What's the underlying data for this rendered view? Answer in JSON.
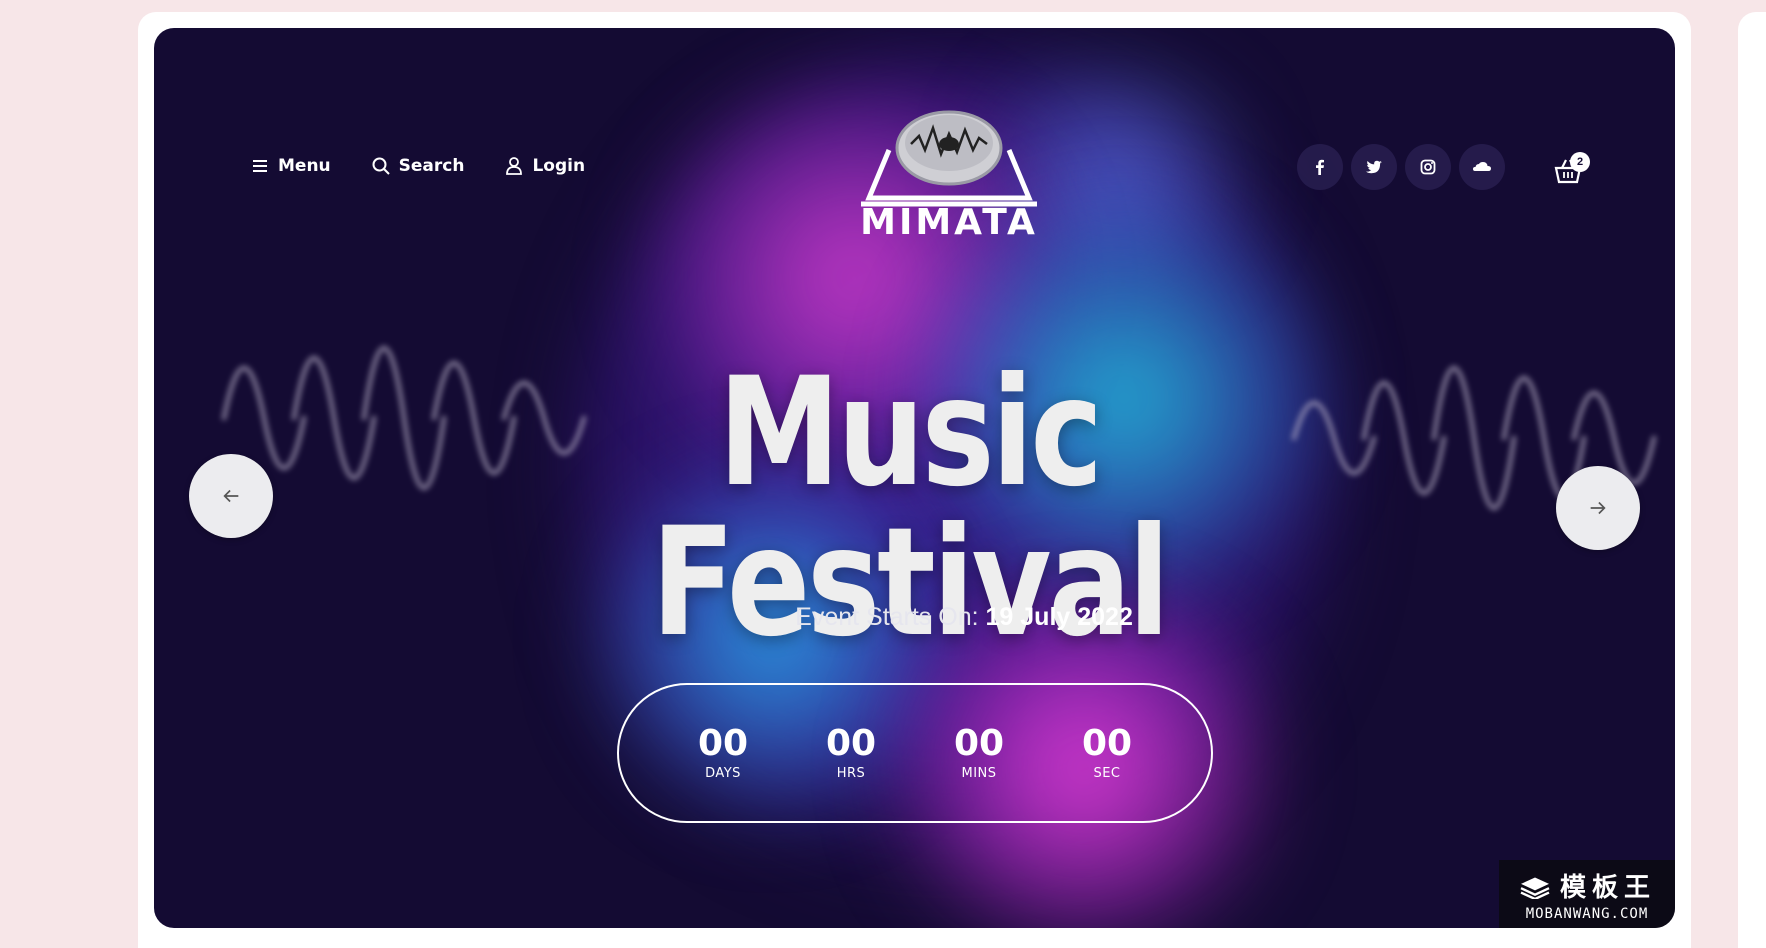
{
  "nav": {
    "menu_label": "Menu",
    "search_label": "Search",
    "login_label": "Login"
  },
  "logo": {
    "text": "MIMATA"
  },
  "social": {
    "icons": [
      "facebook-icon",
      "twitter-icon",
      "instagram-icon",
      "soundcloud-icon"
    ]
  },
  "cart": {
    "count": "2"
  },
  "hero": {
    "title": "Music Festival",
    "event_prefix": "Event Starts On:",
    "event_date": "19 July 2022"
  },
  "countdown": {
    "days": {
      "value": "00",
      "label": "DAYS"
    },
    "hours": {
      "value": "00",
      "label": "HRS"
    },
    "mins": {
      "value": "00",
      "label": "MINS"
    },
    "secs": {
      "value": "00",
      "label": "SEC"
    }
  },
  "watermark": {
    "top": "模板王",
    "bottom": "MOBANWANG.COM"
  },
  "colors": {
    "page_bg": "#f7e6e8",
    "hero_bg": "#140b33",
    "magenta": "#e240d6",
    "cyan": "#1ecde6"
  }
}
